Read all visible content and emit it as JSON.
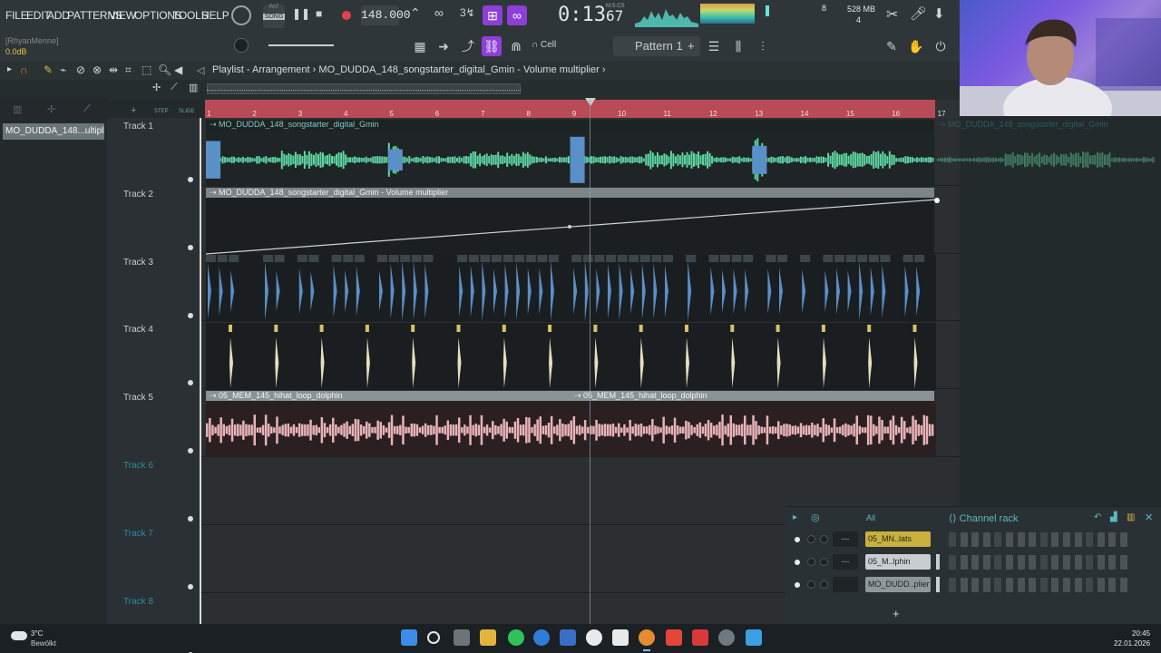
{
  "menu": [
    "FILE",
    "EDIT",
    "ADD",
    "PATTERNS",
    "VIEW",
    "OPTIONS",
    "TOOLS",
    "HELP"
  ],
  "transport": {
    "pat_label": "PAT",
    "song_label": "SONG",
    "tempo": "148.000",
    "time": "0:13",
    "time_ms": "67",
    "time_unit": "M:S:CS",
    "memory": "528 MB",
    "memory_sub": "4",
    "cpu_num": "8"
  },
  "toolbar": {
    "hint_user": "[RhyanMenne]",
    "hint_value": "0.0dB",
    "cell_label": "Cell",
    "pattern_label": "Pattern 1",
    "step_label": "STEP",
    "slide_label": "SLIDE"
  },
  "breadcrumb": {
    "root": "Playlist - Arrangement",
    "sep": "›",
    "item": "MO_DUDDA_148_songstarter_digital_Gmin - Volume multiplier",
    "tail": "›"
  },
  "left_panel": {
    "selected_clip": "MO_DUDDA_148...ultiplier"
  },
  "ruler": {
    "bars": [
      "1",
      "2",
      "3",
      "4",
      "5",
      "6",
      "7",
      "8",
      "9",
      "10",
      "11",
      "12",
      "13",
      "14",
      "15",
      "16",
      "17"
    ]
  },
  "tracks": [
    {
      "label": "Track 1",
      "clip": "MO_DUDDA_148_songstarter_digital_Gmin",
      "clip2": "MO_DUDDA_148_songstarter_digital_Gmin"
    },
    {
      "label": "Track 2",
      "clip": "MO_DUDDA_148_songstarter_digital_Gmin - Volume multiplier"
    },
    {
      "label": "Track 3"
    },
    {
      "label": "Track 4"
    },
    {
      "label": "Track 5",
      "clip": "05_MEM_145_hihat_loop_dolphin",
      "clip2": "05_MEM_145_hihat_loop_dolphin"
    },
    {
      "label": "Track 6"
    },
    {
      "label": "Track 7"
    },
    {
      "label": "Track 8"
    }
  ],
  "channel_rack": {
    "title": "Channel rack",
    "filter": "All",
    "channels": [
      {
        "name": "05_MN..lats",
        "color": "#c9b13b",
        "vol": "---"
      },
      {
        "name": "05_M..lphin",
        "color": "#c7cdd0",
        "vol": "---"
      },
      {
        "name": "MO_DUDD..plier",
        "color": "#8e989b",
        "vol": ""
      }
    ],
    "add": "+"
  },
  "taskbar": {
    "weather_temp": "3°C",
    "weather_desc": "Bewölkt",
    "time": "20:45",
    "date": "22.01.2026"
  },
  "colors": {
    "accent_purple": "#8d3fd6",
    "ruler_red": "#b94a57",
    "wave_green": "#5ed8a0",
    "wave_blue": "#5a8fc8",
    "wave_pink": "#e8b3b8",
    "marker_yellow": "#d8c06a"
  }
}
